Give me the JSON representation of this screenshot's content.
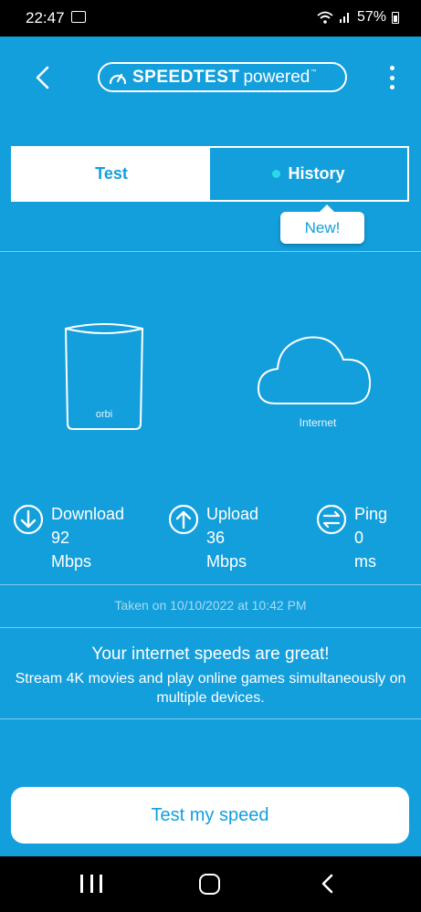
{
  "status_bar": {
    "time": "22:47",
    "battery": "57%"
  },
  "header": {
    "logo_main": "SPEEDTEST",
    "logo_sub": "powered",
    "logo_tm": "™"
  },
  "tabs": [
    {
      "label": "Test",
      "selected": true
    },
    {
      "label": "History",
      "selected": false
    }
  ],
  "new_badge": "New!",
  "devices": {
    "router_label": "orbi",
    "internet_label": "Internet"
  },
  "metrics": {
    "download": {
      "label": "Download",
      "value": "92",
      "unit": "Mbps"
    },
    "upload": {
      "label": "Upload",
      "value": "36",
      "unit": "Mbps"
    },
    "ping": {
      "label": "Ping",
      "value": "0",
      "unit": "ms"
    }
  },
  "taken_text": "Taken on 10/10/2022 at 10:42 PM",
  "result": {
    "title": "Your internet speeds are great!",
    "description": "Stream 4K movies and play online games simultaneously on multiple devices."
  },
  "test_button_label": "Test my speed",
  "colors": {
    "accent": "#139fdc",
    "dot": "#29d9e9"
  }
}
